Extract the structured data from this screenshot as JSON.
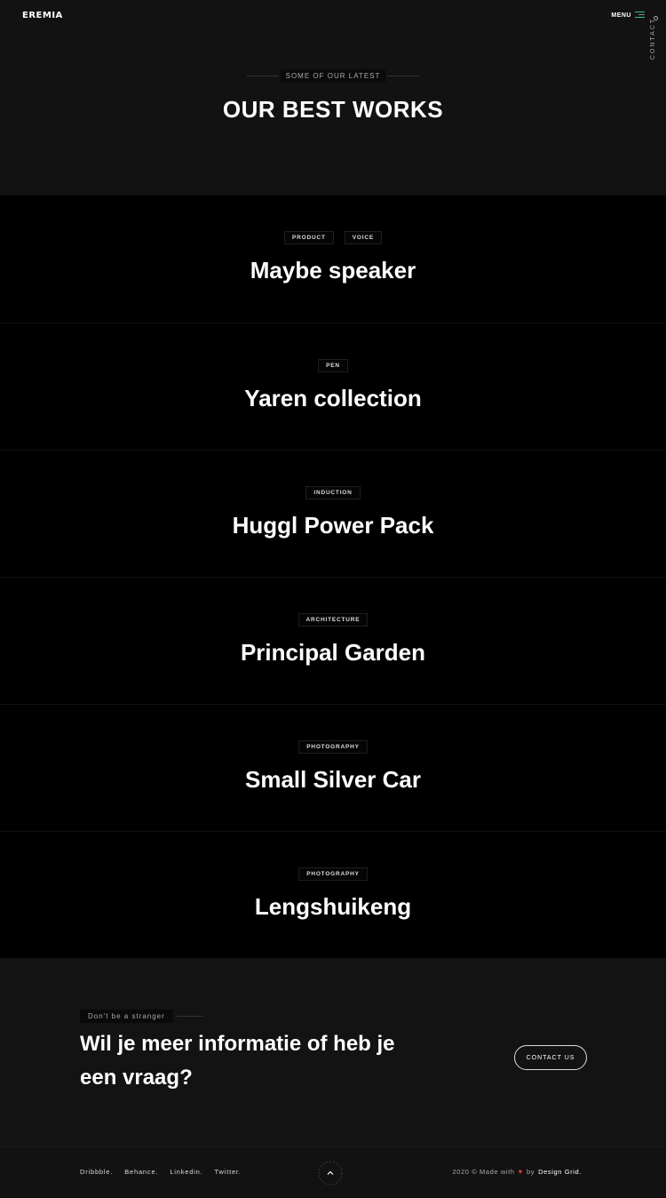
{
  "header": {
    "logo": "EREMIA",
    "menu_label": "MENU",
    "contact_label": "CONTACT",
    "eyebrow": "SOME OF OUR LATEST",
    "title": "OUR BEST WORKS"
  },
  "works": [
    {
      "tags": [
        "PRODUCT",
        "VOICE"
      ],
      "title": "Maybe speaker"
    },
    {
      "tags": [
        "PEN"
      ],
      "title": "Yaren collection"
    },
    {
      "tags": [
        "INDUCTION"
      ],
      "title": "Huggl Power Pack"
    },
    {
      "tags": [
        "ARCHITECTURE"
      ],
      "title": "Principal Garden"
    },
    {
      "tags": [
        "PHOTOGRAPHY"
      ],
      "title": "Small Silver Car"
    },
    {
      "tags": [
        "PHOTOGRAPHY"
      ],
      "title": "Lengshuikeng"
    }
  ],
  "cta": {
    "eyebrow": "Don't be a stranger",
    "heading": "Wil je meer informatie of heb je een vraag?",
    "button_label": "CONTACT US"
  },
  "footer": {
    "socials": [
      "Dribbble.",
      "Behance.",
      "Linkedin.",
      "Twitter."
    ],
    "credit_prefix": "2020 © Made with",
    "credit_by": "by",
    "credit_brand": "Design Grid.",
    "scroll_top_icon": "chevron-up-icon"
  },
  "colors": {
    "background": "#121212",
    "works_background": "#000000",
    "accent": "#2ec4a6",
    "heart": "#e53935"
  }
}
